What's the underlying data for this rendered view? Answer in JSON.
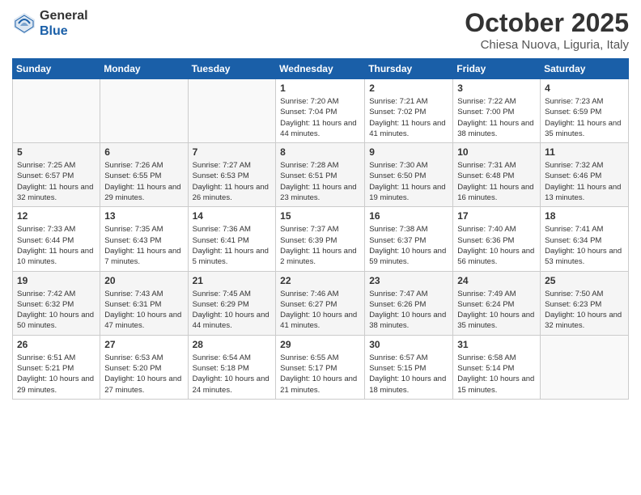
{
  "logo": {
    "general": "General",
    "blue": "Blue"
  },
  "title": "October 2025",
  "subtitle": "Chiesa Nuova, Liguria, Italy",
  "weekdays": [
    "Sunday",
    "Monday",
    "Tuesday",
    "Wednesday",
    "Thursday",
    "Friday",
    "Saturday"
  ],
  "weeks": [
    [
      {
        "day": "",
        "info": ""
      },
      {
        "day": "",
        "info": ""
      },
      {
        "day": "",
        "info": ""
      },
      {
        "day": "1",
        "info": "Sunrise: 7:20 AM\nSunset: 7:04 PM\nDaylight: 11 hours and 44 minutes."
      },
      {
        "day": "2",
        "info": "Sunrise: 7:21 AM\nSunset: 7:02 PM\nDaylight: 11 hours and 41 minutes."
      },
      {
        "day": "3",
        "info": "Sunrise: 7:22 AM\nSunset: 7:00 PM\nDaylight: 11 hours and 38 minutes."
      },
      {
        "day": "4",
        "info": "Sunrise: 7:23 AM\nSunset: 6:59 PM\nDaylight: 11 hours and 35 minutes."
      }
    ],
    [
      {
        "day": "5",
        "info": "Sunrise: 7:25 AM\nSunset: 6:57 PM\nDaylight: 11 hours and 32 minutes."
      },
      {
        "day": "6",
        "info": "Sunrise: 7:26 AM\nSunset: 6:55 PM\nDaylight: 11 hours and 29 minutes."
      },
      {
        "day": "7",
        "info": "Sunrise: 7:27 AM\nSunset: 6:53 PM\nDaylight: 11 hours and 26 minutes."
      },
      {
        "day": "8",
        "info": "Sunrise: 7:28 AM\nSunset: 6:51 PM\nDaylight: 11 hours and 23 minutes."
      },
      {
        "day": "9",
        "info": "Sunrise: 7:30 AM\nSunset: 6:50 PM\nDaylight: 11 hours and 19 minutes."
      },
      {
        "day": "10",
        "info": "Sunrise: 7:31 AM\nSunset: 6:48 PM\nDaylight: 11 hours and 16 minutes."
      },
      {
        "day": "11",
        "info": "Sunrise: 7:32 AM\nSunset: 6:46 PM\nDaylight: 11 hours and 13 minutes."
      }
    ],
    [
      {
        "day": "12",
        "info": "Sunrise: 7:33 AM\nSunset: 6:44 PM\nDaylight: 11 hours and 10 minutes."
      },
      {
        "day": "13",
        "info": "Sunrise: 7:35 AM\nSunset: 6:43 PM\nDaylight: 11 hours and 7 minutes."
      },
      {
        "day": "14",
        "info": "Sunrise: 7:36 AM\nSunset: 6:41 PM\nDaylight: 11 hours and 5 minutes."
      },
      {
        "day": "15",
        "info": "Sunrise: 7:37 AM\nSunset: 6:39 PM\nDaylight: 11 hours and 2 minutes."
      },
      {
        "day": "16",
        "info": "Sunrise: 7:38 AM\nSunset: 6:37 PM\nDaylight: 10 hours and 59 minutes."
      },
      {
        "day": "17",
        "info": "Sunrise: 7:40 AM\nSunset: 6:36 PM\nDaylight: 10 hours and 56 minutes."
      },
      {
        "day": "18",
        "info": "Sunrise: 7:41 AM\nSunset: 6:34 PM\nDaylight: 10 hours and 53 minutes."
      }
    ],
    [
      {
        "day": "19",
        "info": "Sunrise: 7:42 AM\nSunset: 6:32 PM\nDaylight: 10 hours and 50 minutes."
      },
      {
        "day": "20",
        "info": "Sunrise: 7:43 AM\nSunset: 6:31 PM\nDaylight: 10 hours and 47 minutes."
      },
      {
        "day": "21",
        "info": "Sunrise: 7:45 AM\nSunset: 6:29 PM\nDaylight: 10 hours and 44 minutes."
      },
      {
        "day": "22",
        "info": "Sunrise: 7:46 AM\nSunset: 6:27 PM\nDaylight: 10 hours and 41 minutes."
      },
      {
        "day": "23",
        "info": "Sunrise: 7:47 AM\nSunset: 6:26 PM\nDaylight: 10 hours and 38 minutes."
      },
      {
        "day": "24",
        "info": "Sunrise: 7:49 AM\nSunset: 6:24 PM\nDaylight: 10 hours and 35 minutes."
      },
      {
        "day": "25",
        "info": "Sunrise: 7:50 AM\nSunset: 6:23 PM\nDaylight: 10 hours and 32 minutes."
      }
    ],
    [
      {
        "day": "26",
        "info": "Sunrise: 6:51 AM\nSunset: 5:21 PM\nDaylight: 10 hours and 29 minutes."
      },
      {
        "day": "27",
        "info": "Sunrise: 6:53 AM\nSunset: 5:20 PM\nDaylight: 10 hours and 27 minutes."
      },
      {
        "day": "28",
        "info": "Sunrise: 6:54 AM\nSunset: 5:18 PM\nDaylight: 10 hours and 24 minutes."
      },
      {
        "day": "29",
        "info": "Sunrise: 6:55 AM\nSunset: 5:17 PM\nDaylight: 10 hours and 21 minutes."
      },
      {
        "day": "30",
        "info": "Sunrise: 6:57 AM\nSunset: 5:15 PM\nDaylight: 10 hours and 18 minutes."
      },
      {
        "day": "31",
        "info": "Sunrise: 6:58 AM\nSunset: 5:14 PM\nDaylight: 10 hours and 15 minutes."
      },
      {
        "day": "",
        "info": ""
      }
    ]
  ]
}
